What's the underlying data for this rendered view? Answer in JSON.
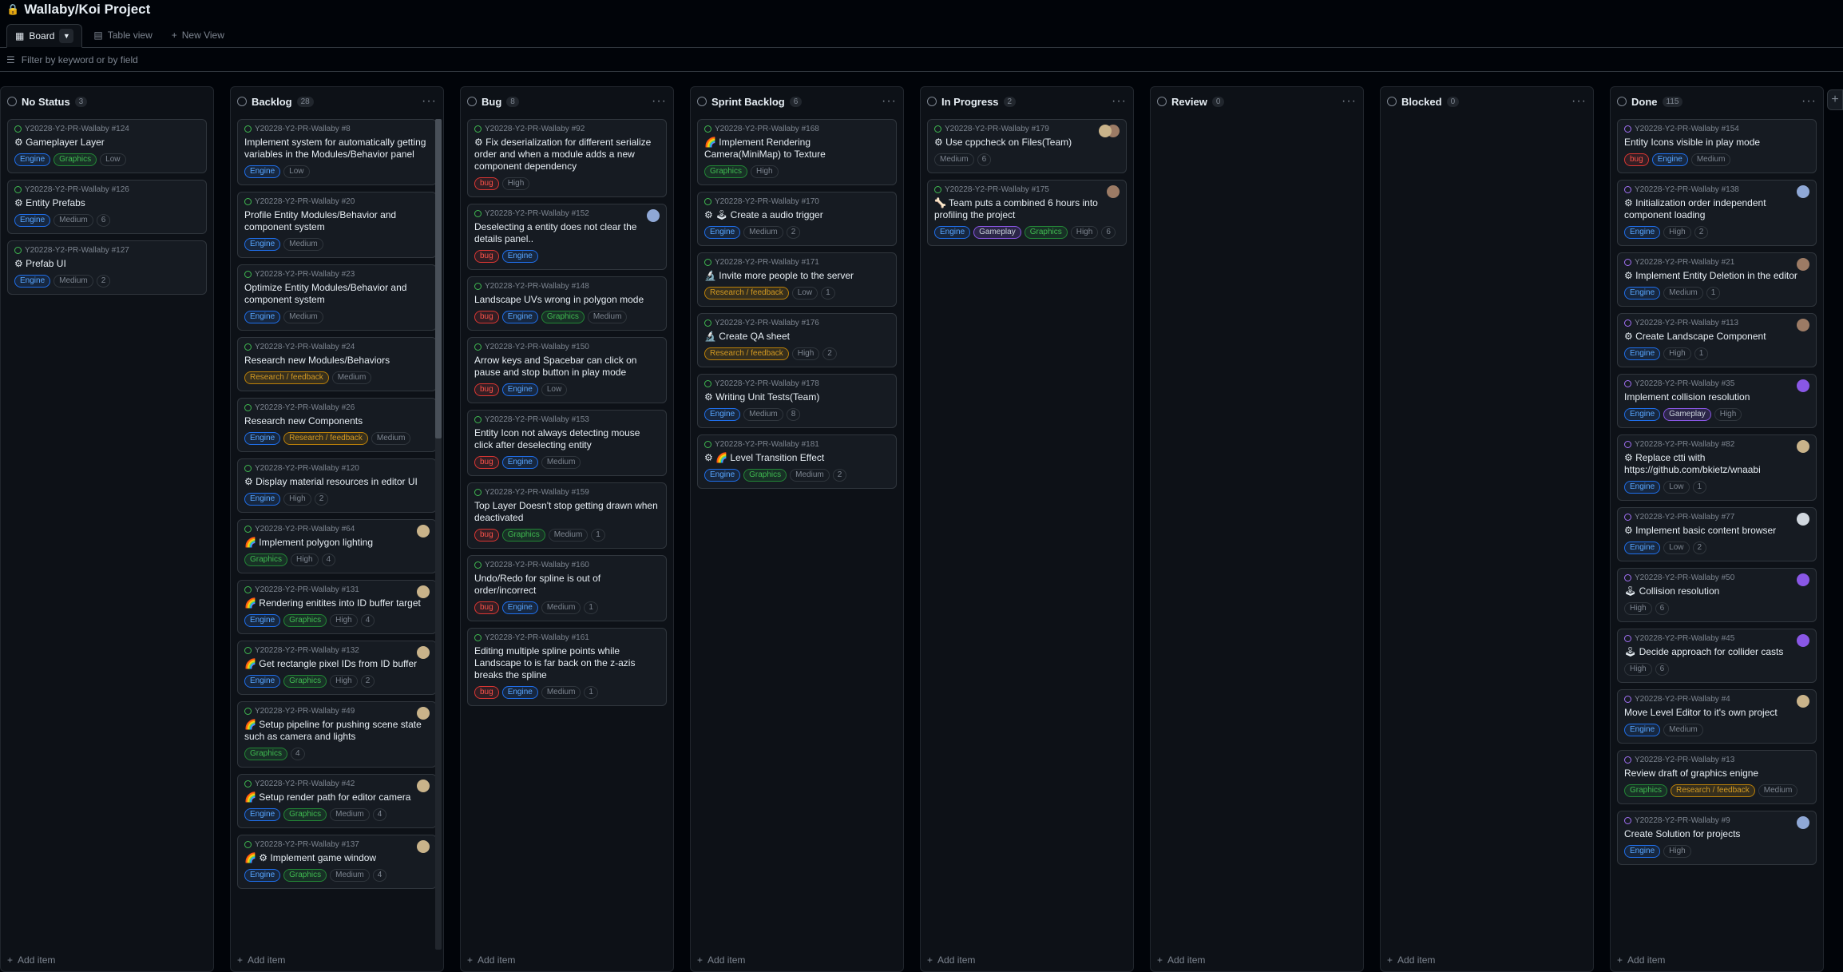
{
  "project": {
    "title": "Wallaby/Koi Project"
  },
  "views": {
    "board": "Board",
    "table": "Table view",
    "new": "New View"
  },
  "filter": {
    "placeholder": "Filter by keyword or by field"
  },
  "add_item": "Add item",
  "columns": [
    {
      "name": "No Status",
      "count": "3",
      "cards": [
        {
          "ref": "Y20228-Y2-PR-Wallaby #124",
          "title": "⚙ Gameplayer Layer",
          "labels": [
            [
              "Engine",
              "engine"
            ],
            [
              "Graphics",
              "graphics"
            ],
            [
              "Low",
              ""
            ]
          ]
        },
        {
          "ref": "Y20228-Y2-PR-Wallaby #126",
          "title": "⚙ Entity Prefabs",
          "labels": [
            [
              "Engine",
              "engine"
            ],
            [
              "Medium",
              ""
            ],
            [
              "6",
              "num"
            ]
          ]
        },
        {
          "ref": "Y20228-Y2-PR-Wallaby #127",
          "title": "⚙ Prefab UI",
          "labels": [
            [
              "Engine",
              "engine"
            ],
            [
              "Medium",
              ""
            ],
            [
              "2",
              "num"
            ]
          ]
        }
      ]
    },
    {
      "name": "Backlog",
      "count": "28",
      "cards": [
        {
          "ref": "Y20228-Y2-PR-Wallaby #8",
          "title": "Implement system for automatically getting variables in the Modules/Behavior panel",
          "labels": [
            [
              "Engine",
              "engine"
            ],
            [
              "Low",
              ""
            ]
          ]
        },
        {
          "ref": "Y20228-Y2-PR-Wallaby #20",
          "title": "Profile Entity Modules/Behavior and component system",
          "labels": [
            [
              "Engine",
              "engine"
            ],
            [
              "Medium",
              ""
            ]
          ]
        },
        {
          "ref": "Y20228-Y2-PR-Wallaby #23",
          "title": "Optimize Entity Modules/Behavior and component system",
          "labels": [
            [
              "Engine",
              "engine"
            ],
            [
              "Medium",
              ""
            ]
          ]
        },
        {
          "ref": "Y20228-Y2-PR-Wallaby #24",
          "title": "Research new Modules/Behaviors",
          "labels": [
            [
              "Research / feedback",
              "research"
            ],
            [
              "Medium",
              ""
            ]
          ]
        },
        {
          "ref": "Y20228-Y2-PR-Wallaby #26",
          "title": "Research new Components",
          "labels": [
            [
              "Engine",
              "engine"
            ],
            [
              "Research / feedback",
              "research"
            ],
            [
              "Medium",
              ""
            ]
          ]
        },
        {
          "ref": "Y20228-Y2-PR-Wallaby #120",
          "title": "⚙ Display material resources in editor UI",
          "labels": [
            [
              "Engine",
              "engine"
            ],
            [
              "High",
              ""
            ],
            [
              "2",
              "num"
            ]
          ]
        },
        {
          "ref": "Y20228-Y2-PR-Wallaby #64",
          "title": "🌈 Implement polygon lighting",
          "labels": [
            [
              "Graphics",
              "graphics"
            ],
            [
              "High",
              ""
            ],
            [
              "4",
              "num"
            ]
          ],
          "avatar": "#c9b38a"
        },
        {
          "ref": "Y20228-Y2-PR-Wallaby #131",
          "title": "🌈 Rendering enitites into ID buffer target",
          "labels": [
            [
              "Engine",
              "engine"
            ],
            [
              "Graphics",
              "graphics"
            ],
            [
              "High",
              ""
            ],
            [
              "4",
              "num"
            ]
          ],
          "avatar": "#c9b38a"
        },
        {
          "ref": "Y20228-Y2-PR-Wallaby #132",
          "title": "🌈 Get rectangle pixel IDs from ID buffer",
          "labels": [
            [
              "Engine",
              "engine"
            ],
            [
              "Graphics",
              "graphics"
            ],
            [
              "High",
              ""
            ],
            [
              "2",
              "num"
            ]
          ],
          "avatar": "#c9b38a"
        },
        {
          "ref": "Y20228-Y2-PR-Wallaby #49",
          "title": "🌈 Setup pipeline for pushing scene state such as camera and lights",
          "labels": [
            [
              "Graphics",
              "graphics"
            ],
            [
              "4",
              "num"
            ]
          ],
          "avatar": "#c9b38a"
        },
        {
          "ref": "Y20228-Y2-PR-Wallaby #42",
          "title": "🌈 Setup render path for editor camera",
          "labels": [
            [
              "Engine",
              "engine"
            ],
            [
              "Graphics",
              "graphics"
            ],
            [
              "Medium",
              ""
            ],
            [
              "4",
              "num"
            ]
          ],
          "avatar": "#c9b38a"
        },
        {
          "ref": "Y20228-Y2-PR-Wallaby #137",
          "title": "🌈 ⚙ Implement game window",
          "labels": [
            [
              "Engine",
              "engine"
            ],
            [
              "Graphics",
              "graphics"
            ],
            [
              "Medium",
              ""
            ],
            [
              "4",
              "num"
            ]
          ],
          "avatar": "#c9b38a"
        }
      ]
    },
    {
      "name": "Bug",
      "count": "8",
      "cards": [
        {
          "ref": "Y20228-Y2-PR-Wallaby #92",
          "title": "⚙ Fix deserialization for different serialize order and when a module adds a new component dependency",
          "labels": [
            [
              "bug",
              "bug"
            ],
            [
              "High",
              ""
            ]
          ]
        },
        {
          "ref": "Y20228-Y2-PR-Wallaby #152",
          "title": "Deselecting a entity does not clear the details panel..",
          "labels": [
            [
              "bug",
              "bug"
            ],
            [
              "Engine",
              "engine"
            ]
          ],
          "avatar": "#8fa8d6"
        },
        {
          "ref": "Y20228-Y2-PR-Wallaby #148",
          "title": "Landscape UVs wrong in polygon mode",
          "labels": [
            [
              "bug",
              "bug"
            ],
            [
              "Engine",
              "engine"
            ],
            [
              "Graphics",
              "graphics"
            ],
            [
              "Medium",
              ""
            ]
          ]
        },
        {
          "ref": "Y20228-Y2-PR-Wallaby #150",
          "title": "Arrow keys and Spacebar can click on pause and stop button in play mode",
          "labels": [
            [
              "bug",
              "bug"
            ],
            [
              "Engine",
              "engine"
            ],
            [
              "Low",
              ""
            ]
          ]
        },
        {
          "ref": "Y20228-Y2-PR-Wallaby #153",
          "title": "Entity Icon not always detecting mouse click after deselecting entity",
          "labels": [
            [
              "bug",
              "bug"
            ],
            [
              "Engine",
              "engine"
            ],
            [
              "Medium",
              ""
            ]
          ]
        },
        {
          "ref": "Y20228-Y2-PR-Wallaby #159",
          "title": "Top Layer Doesn't stop getting drawn when deactivated",
          "labels": [
            [
              "bug",
              "bug"
            ],
            [
              "Graphics",
              "graphics"
            ],
            [
              "Medium",
              ""
            ],
            [
              "1",
              "num"
            ]
          ]
        },
        {
          "ref": "Y20228-Y2-PR-Wallaby #160",
          "title": "Undo/Redo for spline is out of order/incorrect",
          "labels": [
            [
              "bug",
              "bug"
            ],
            [
              "Engine",
              "engine"
            ],
            [
              "Medium",
              ""
            ],
            [
              "1",
              "num"
            ]
          ]
        },
        {
          "ref": "Y20228-Y2-PR-Wallaby #161",
          "title": "Editing multiple spline points while Landscape to is far back on the z-azis breaks the spline",
          "labels": [
            [
              "bug",
              "bug"
            ],
            [
              "Engine",
              "engine"
            ],
            [
              "Medium",
              ""
            ],
            [
              "1",
              "num"
            ]
          ]
        }
      ]
    },
    {
      "name": "Sprint Backlog",
      "count": "6",
      "cards": [
        {
          "ref": "Y20228-Y2-PR-Wallaby #168",
          "title": "🌈 Implement Rendering Camera(MiniMap) to Texture",
          "labels": [
            [
              "Graphics",
              "graphics"
            ],
            [
              "High",
              ""
            ]
          ]
        },
        {
          "ref": "Y20228-Y2-PR-Wallaby #170",
          "title": "⚙ 🕹 Create a audio trigger",
          "labels": [
            [
              "Engine",
              "engine"
            ],
            [
              "Medium",
              ""
            ],
            [
              "2",
              "num"
            ]
          ]
        },
        {
          "ref": "Y20228-Y2-PR-Wallaby #171",
          "title": "🔬 Invite more people to the server",
          "labels": [
            [
              "Research / feedback",
              "research"
            ],
            [
              "Low",
              ""
            ],
            [
              "1",
              "num"
            ]
          ]
        },
        {
          "ref": "Y20228-Y2-PR-Wallaby #176",
          "title": "🔬 Create QA sheet",
          "labels": [
            [
              "Research / feedback",
              "research"
            ],
            [
              "High",
              ""
            ],
            [
              "2",
              "num"
            ]
          ]
        },
        {
          "ref": "Y20228-Y2-PR-Wallaby #178",
          "title": "⚙ Writing Unit Tests(Team)",
          "labels": [
            [
              "Engine",
              "engine"
            ],
            [
              "Medium",
              ""
            ],
            [
              "8",
              "num"
            ]
          ]
        },
        {
          "ref": "Y20228-Y2-PR-Wallaby #181",
          "title": "⚙ 🌈 Level Transition Effect",
          "labels": [
            [
              "Engine",
              "engine"
            ],
            [
              "Graphics",
              "graphics"
            ],
            [
              "Medium",
              ""
            ],
            [
              "2",
              "num"
            ]
          ]
        }
      ]
    },
    {
      "name": "In Progress",
      "count": "2",
      "cards": [
        {
          "ref": "Y20228-Y2-PR-Wallaby #179",
          "title": "⚙ Use cppcheck on Files(Team)",
          "labels": [
            [
              "Medium",
              ""
            ],
            [
              "6",
              "num"
            ]
          ],
          "avatar": "#9c7b65",
          "avatar2": "#c9b38a"
        },
        {
          "ref": "Y20228-Y2-PR-Wallaby #175",
          "title": "🦴 Team puts a combined 6 hours into profiling the project",
          "labels": [
            [
              "Engine",
              "engine"
            ],
            [
              "Gameplay",
              "gameplay"
            ],
            [
              "Graphics",
              "graphics"
            ],
            [
              "High",
              ""
            ],
            [
              "6",
              "num"
            ]
          ],
          "avatar": "#9c7b65"
        }
      ]
    },
    {
      "name": "Review",
      "count": "0",
      "cards": []
    },
    {
      "name": "Blocked",
      "count": "0",
      "cards": []
    },
    {
      "name": "Done",
      "count": "115",
      "done": true,
      "cards": [
        {
          "ref": "Y20228-Y2-PR-Wallaby #154",
          "title": "Entity Icons visible in play mode",
          "labels": [
            [
              "bug",
              "bug"
            ],
            [
              "Engine",
              "engine"
            ],
            [
              "Medium",
              ""
            ]
          ]
        },
        {
          "ref": "Y20228-Y2-PR-Wallaby #138",
          "title": "⚙ Initialization order independent component loading",
          "labels": [
            [
              "Engine",
              "engine"
            ],
            [
              "High",
              ""
            ],
            [
              "2",
              "num"
            ]
          ],
          "avatar": "#8fa8d6"
        },
        {
          "ref": "Y20228-Y2-PR-Wallaby #21",
          "title": "⚙ Implement Entity Deletion in the editor",
          "labels": [
            [
              "Engine",
              "engine"
            ],
            [
              "Medium",
              ""
            ],
            [
              "1",
              "num"
            ]
          ],
          "avatar": "#9c7b65"
        },
        {
          "ref": "Y20228-Y2-PR-Wallaby #113",
          "title": "⚙ Create Landscape Component",
          "labels": [
            [
              "Engine",
              "engine"
            ],
            [
              "High",
              ""
            ],
            [
              "1",
              "num"
            ]
          ],
          "avatar": "#9c7b65"
        },
        {
          "ref": "Y20228-Y2-PR-Wallaby #35",
          "title": "Implement collision resolution",
          "labels": [
            [
              "Engine",
              "engine"
            ],
            [
              "Gameplay",
              "gameplay"
            ],
            [
              "High",
              ""
            ]
          ],
          "avatar": "#8957e5"
        },
        {
          "ref": "Y20228-Y2-PR-Wallaby #82",
          "title": "⚙ Replace ctti with https://github.com/bkietz/wnaabi",
          "labels": [
            [
              "Engine",
              "engine"
            ],
            [
              "Low",
              ""
            ],
            [
              "1",
              "num"
            ]
          ],
          "avatar": "#c9b38a"
        },
        {
          "ref": "Y20228-Y2-PR-Wallaby #77",
          "title": "⚙ Implement basic content browser",
          "labels": [
            [
              "Engine",
              "engine"
            ],
            [
              "Low",
              ""
            ],
            [
              "2",
              "num"
            ]
          ],
          "avatar": "#d0d7de"
        },
        {
          "ref": "Y20228-Y2-PR-Wallaby #50",
          "title": "🕹 Collision resolution",
          "labels": [
            [
              "High",
              ""
            ],
            [
              "6",
              "num"
            ]
          ],
          "avatar": "#8957e5"
        },
        {
          "ref": "Y20228-Y2-PR-Wallaby #45",
          "title": "🕹 Decide approach for collider casts",
          "labels": [
            [
              "High",
              ""
            ],
            [
              "6",
              "num"
            ]
          ],
          "avatar": "#8957e5"
        },
        {
          "ref": "Y20228-Y2-PR-Wallaby #4",
          "title": "Move Level Editor to it's own project",
          "labels": [
            [
              "Engine",
              "engine"
            ],
            [
              "Medium",
              ""
            ]
          ],
          "avatar": "#c9b38a"
        },
        {
          "ref": "Y20228-Y2-PR-Wallaby #13",
          "title": "Review draft of graphics enigne",
          "labels": [
            [
              "Graphics",
              "graphics"
            ],
            [
              "Research / feedback",
              "research"
            ],
            [
              "Medium",
              ""
            ]
          ]
        },
        {
          "ref": "Y20228-Y2-PR-Wallaby #9",
          "title": "Create Solution for projects",
          "labels": [
            [
              "Engine",
              "engine"
            ],
            [
              "High",
              ""
            ]
          ],
          "avatar": "#8fa8d6"
        }
      ]
    }
  ]
}
